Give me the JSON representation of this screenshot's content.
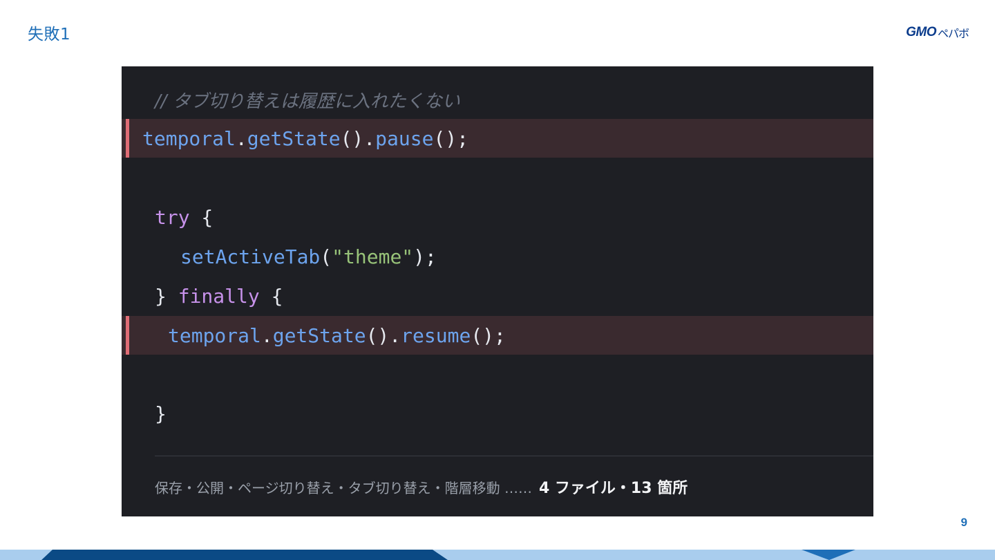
{
  "slide": {
    "title": "失敗1",
    "page_number": "9",
    "brand": {
      "logo_text": "GMO",
      "logo_kana": "ペパボ"
    }
  },
  "code": {
    "comment": "// タブ切り替えは履歴に入れたくない",
    "line1": {
      "obj": "temporal",
      "dot1": ".",
      "fn1": "getState",
      "p1": "().",
      "fn2": "pause",
      "p2": "();"
    },
    "line_try": {
      "kw": "try",
      "brace": " {"
    },
    "line_set": {
      "fn": "setActiveTab",
      "open": "(",
      "str": "\"theme\"",
      "close": ");"
    },
    "line_finally": {
      "brace1": "} ",
      "kw": "finally",
      "brace2": " {"
    },
    "line2": {
      "obj": "temporal",
      "dot1": ".",
      "fn1": "getState",
      "p1": "().",
      "fn2": "resume",
      "p2": "();"
    },
    "line_close": "}"
  },
  "footer": {
    "list": "保存・公開・ページ切り替え・タブ切り替え・階層移動 ……",
    "summary": "4 ファイル・13 箇所"
  },
  "colors": {
    "title": "#1f6fb8",
    "panel_bg": "#1e1f24",
    "highlight_bg": "#3a2a2f",
    "highlight_bar": "#e06c75",
    "band_dark": "#0b4a85",
    "band_light": "#a9cdee"
  }
}
